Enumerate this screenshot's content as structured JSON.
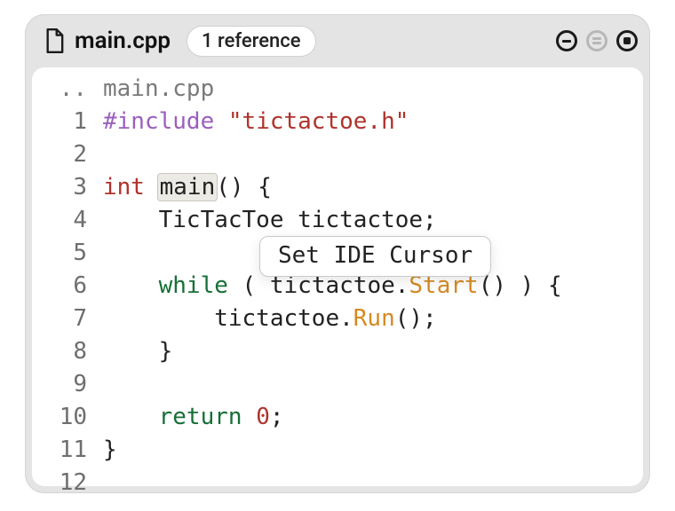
{
  "header": {
    "filename": "main.cpp",
    "reference_pill": "1 reference"
  },
  "breadcrumb": {
    "prefix": "..",
    "file": "main.cpp"
  },
  "popup": {
    "label": "Set IDE Cursor"
  },
  "code": {
    "lines": [
      {
        "n": "1",
        "tokens": [
          {
            "t": "#include ",
            "c": "pp"
          },
          {
            "t": "\"tictactoe.h\"",
            "c": "str"
          }
        ]
      },
      {
        "n": "2",
        "tokens": []
      },
      {
        "n": "3",
        "tokens": [
          {
            "t": "int",
            "c": "ty"
          },
          {
            "t": " ",
            "c": "txt"
          },
          {
            "t": "main",
            "c": "txt",
            "hl": true
          },
          {
            "t": "() {",
            "c": "txt"
          }
        ]
      },
      {
        "n": "4",
        "tokens": [
          {
            "t": "    TicTacToe tictactoe;",
            "c": "txt"
          }
        ]
      },
      {
        "n": "5",
        "tokens": []
      },
      {
        "n": "6",
        "tokens": [
          {
            "t": "    ",
            "c": "txt"
          },
          {
            "t": "while",
            "c": "kw"
          },
          {
            "t": " ( tictactoe.",
            "c": "txt"
          },
          {
            "t": "Start",
            "c": "fn"
          },
          {
            "t": "() ) {",
            "c": "txt"
          }
        ]
      },
      {
        "n": "7",
        "tokens": [
          {
            "t": "        tictactoe.",
            "c": "txt"
          },
          {
            "t": "Run",
            "c": "fn"
          },
          {
            "t": "();",
            "c": "txt"
          }
        ]
      },
      {
        "n": "8",
        "tokens": [
          {
            "t": "    }",
            "c": "txt"
          }
        ]
      },
      {
        "n": "9",
        "tokens": []
      },
      {
        "n": "10",
        "tokens": [
          {
            "t": "    ",
            "c": "txt"
          },
          {
            "t": "return",
            "c": "kw"
          },
          {
            "t": " ",
            "c": "txt"
          },
          {
            "t": "0",
            "c": "num"
          },
          {
            "t": ";",
            "c": "txt"
          }
        ]
      },
      {
        "n": "11",
        "tokens": [
          {
            "t": "}",
            "c": "txt"
          }
        ]
      },
      {
        "n": "12",
        "tokens": []
      }
    ]
  }
}
